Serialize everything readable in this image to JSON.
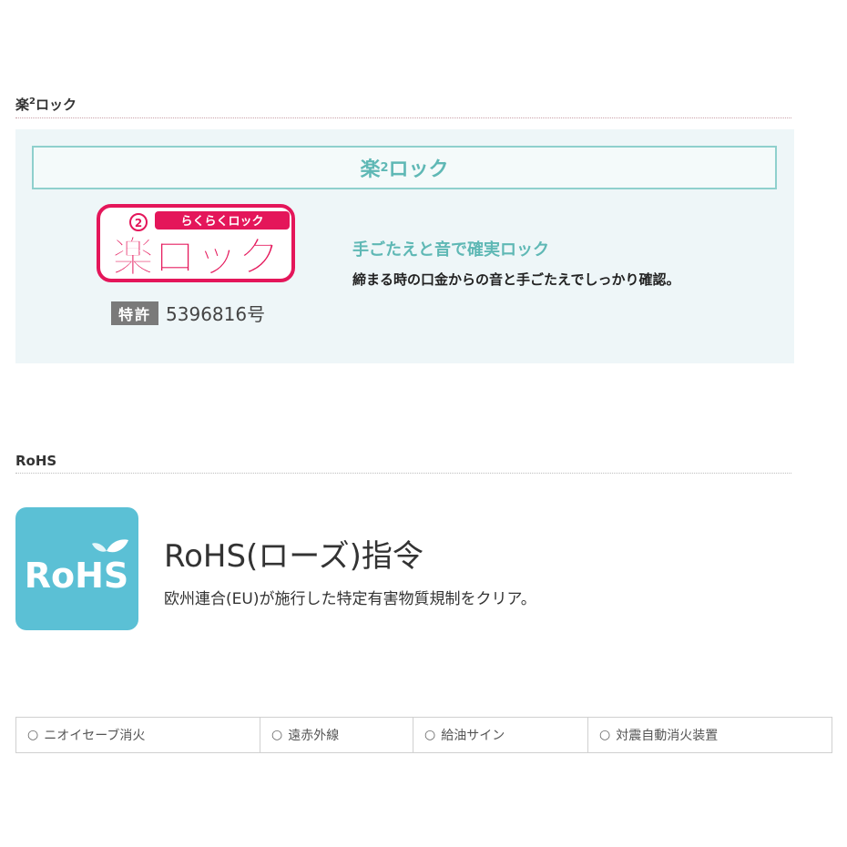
{
  "rakurock": {
    "heading": "楽",
    "heading_sup": "2",
    "heading_tail": "ロック",
    "title": "楽",
    "title_sup": "2",
    "title_tail": "ロック",
    "logo_text_main": "楽ロック",
    "logo_text_kana": "らくらくロック",
    "patent_label": "特許",
    "patent_number": "5396816号",
    "catch": "手ごたえと音で確実ロック",
    "description": "締まる時の口金からの音と手ごたえでしっかり確認。",
    "colors": {
      "accent": "#5fb8b5",
      "logo": "#e4165a",
      "panel": "#eef6f8"
    }
  },
  "rohs": {
    "heading": "RoHS",
    "icon_text": "RoHS",
    "title": "RoHS(ローズ)指令",
    "description": "欧州連合(EU)が施行した特定有害物質規制をクリア。",
    "colors": {
      "icon_bg": "#5bc0d5"
    }
  },
  "features": [
    {
      "marker": "○",
      "label": "ニオイセーブ消火"
    },
    {
      "marker": "○",
      "label": "遠赤外線"
    },
    {
      "marker": "○",
      "label": "給油サイン"
    },
    {
      "marker": "○",
      "label": "対震自動消火装置"
    }
  ]
}
